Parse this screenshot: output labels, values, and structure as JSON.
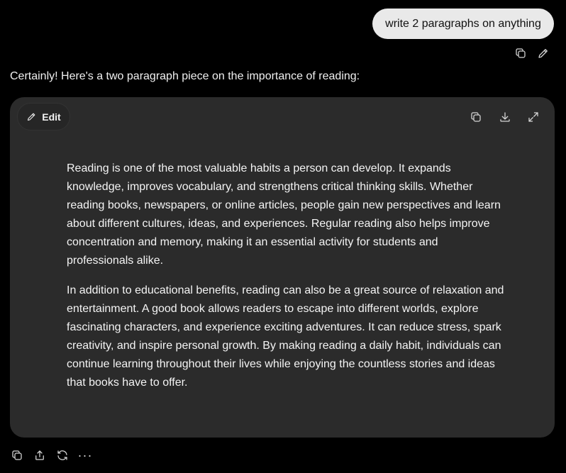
{
  "user_message": {
    "text": "write 2 paragraphs on anything"
  },
  "user_actions": {
    "copy_icon": "copy-icon",
    "edit_icon": "pencil-icon"
  },
  "assistant": {
    "intro": "Certainly! Here's a two paragraph piece on the importance of reading:",
    "canvas": {
      "edit_label": "Edit",
      "toolbar_icons": [
        "copy-icon",
        "download-icon",
        "expand-icon"
      ],
      "paragraphs": [
        "Reading is one of the most valuable habits a person can develop. It expands knowledge, improves vocabulary, and strengthens critical thinking skills. Whether reading books, newspapers, or online articles, people gain new perspectives and learn about different cultures, ideas, and experiences. Regular reading also helps improve concentration and memory, making it an essential activity for students and professionals alike.",
        "In addition to educational benefits, reading can also be a great source of relaxation and entertainment. A good book allows readers to escape into different worlds, explore fascinating characters, and experience exciting adventures. It can reduce stress, spark creativity, and inspire personal growth. By making reading a daily habit, individuals can continue learning throughout their lives while enjoying the countless stories and ideas that books have to offer."
      ]
    },
    "actions": {
      "icons": [
        "copy-icon",
        "share-icon",
        "regenerate-icon",
        "more-icon"
      ],
      "more_label": "···"
    }
  },
  "colors": {
    "background": "#000000",
    "user_bubble": "#e9e9e9",
    "canvas_card": "#2b2b2b",
    "text": "#f4f4f4"
  }
}
